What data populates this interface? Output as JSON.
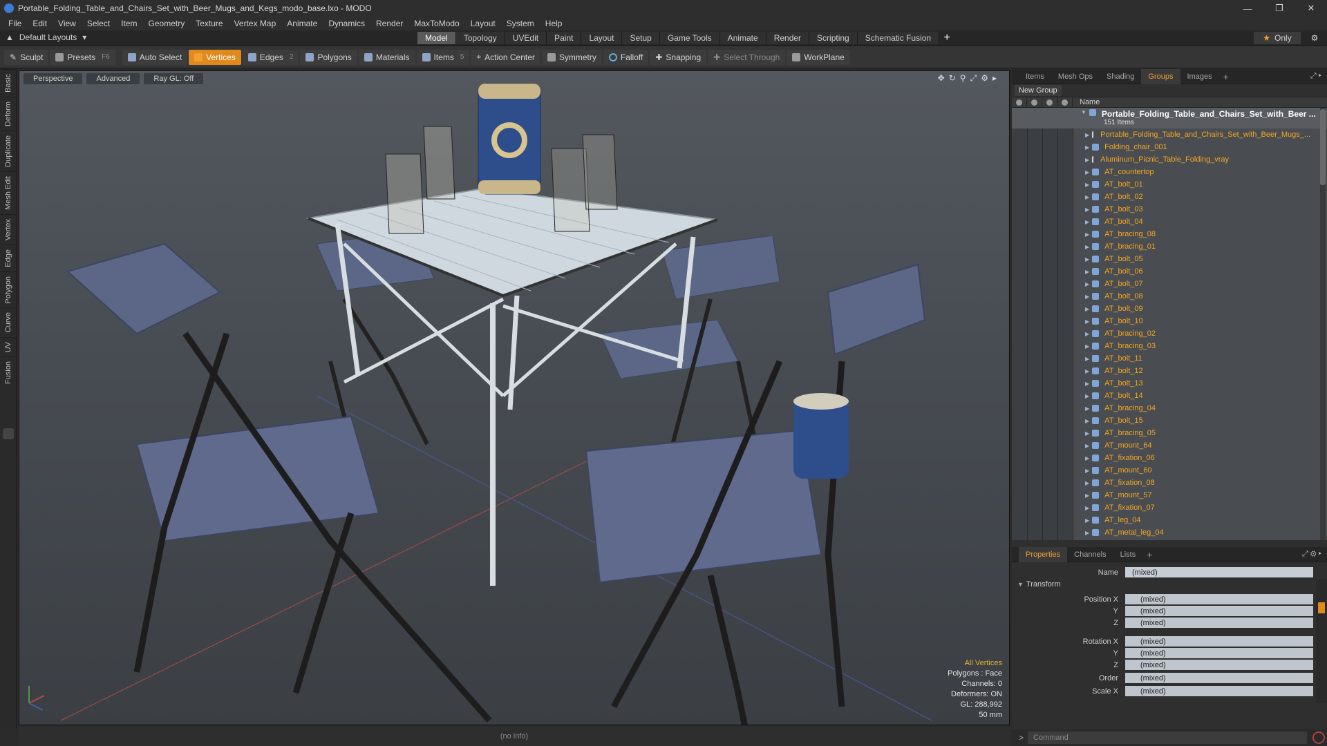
{
  "window": {
    "title": "Portable_Folding_Table_and_Chairs_Set_with_Beer_Mugs_and_Kegs_modo_base.lxo - MODO"
  },
  "menu": [
    "File",
    "Edit",
    "View",
    "Select",
    "Item",
    "Geometry",
    "Texture",
    "Vertex Map",
    "Animate",
    "Dynamics",
    "Render",
    "MaxToModo",
    "Layout",
    "System",
    "Help"
  ],
  "layouts": {
    "default": "Default Layouts",
    "tabs": [
      "Model",
      "Topology",
      "UVEdit",
      "Paint",
      "Layout",
      "Setup",
      "Game Tools",
      "Animate",
      "Render",
      "Scripting",
      "Schematic Fusion"
    ],
    "active": "Model",
    "only": "Only"
  },
  "toolbar": {
    "sculpt": "Sculpt",
    "presets": "Presets",
    "presets_hint": "F6",
    "auto_select": "Auto Select",
    "vertices": "Vertices",
    "edges": "Edges",
    "edges_hint": "2",
    "polygons": "Polygons",
    "materials": "Materials",
    "items": "Items",
    "items_hint": "5",
    "action_center": "Action Center",
    "symmetry": "Symmetry",
    "falloff": "Falloff",
    "snapping": "Snapping",
    "select_through": "Select Through",
    "workplane": "WorkPlane"
  },
  "left_tabs": [
    "Basic",
    "Deform",
    "Duplicate",
    "Mesh Edit",
    "Vertex",
    "Edge",
    "Polygon",
    "Curve",
    "UV",
    "Fusion"
  ],
  "viewport": {
    "view": "Perspective",
    "shading": "Advanced",
    "raygl": "Ray GL: Off",
    "info": {
      "selection": "All Vertices",
      "polygons": "Polygons : Face",
      "channels": "Channels: 0",
      "deformers": "Deformers: ON",
      "gl": "GL: 288,992",
      "focal": "50 mm"
    },
    "status": "(no info)"
  },
  "items_panel": {
    "tabs": [
      "Items",
      "Mesh Ops",
      "Shading",
      "Groups",
      "Images"
    ],
    "active": "Groups",
    "new_group": "New Group",
    "name_header": "Name",
    "root": {
      "name": "Portable_Folding_Table_and_Chairs_Set_with_Beer ...",
      "count": "151 Items"
    },
    "rows": [
      "Portable_Folding_Table_and_Chairs_Set_with_Beer_Mugs_...",
      "Folding_chair_001",
      "Aluminum_Picnic_Table_Folding_vray",
      "AT_countertop",
      "AT_bolt_01",
      "AT_bolt_02",
      "AT_bolt_03",
      "AT_bolt_04",
      "AT_bracing_08",
      "AT_bracing_01",
      "AT_bolt_05",
      "AT_bolt_06",
      "AT_bolt_07",
      "AT_bolt_08",
      "AT_bolt_09",
      "AT_bolt_10",
      "AT_bracing_02",
      "AT_bracing_03",
      "AT_bolt_11",
      "AT_bolt_12",
      "AT_bolt_13",
      "AT_bolt_14",
      "AT_bracing_04",
      "AT_bolt_15",
      "AT_bracing_05",
      "AT_mount_64",
      "AT_fixation_06",
      "AT_mount_60",
      "AT_fixation_08",
      "AT_mount_57",
      "AT_fixation_07",
      "AT_leg_04",
      "AT_metal_leg_04"
    ]
  },
  "properties_panel": {
    "tabs": [
      "Properties",
      "Channels",
      "Lists"
    ],
    "active": "Properties",
    "name_label": "Name",
    "name_value": "(mixed)",
    "transform": "Transform",
    "position": {
      "x_label": "Position X",
      "y_label": "Y",
      "z_label": "Z",
      "x": "(mixed)",
      "y": "(mixed)",
      "z": "(mixed)"
    },
    "rotation": {
      "x_label": "Rotation X",
      "y_label": "Y",
      "z_label": "Z",
      "x": "(mixed)",
      "y": "(mixed)",
      "z": "(mixed)"
    },
    "order_label": "Order",
    "order_value": "(mixed)",
    "scale_label": "Scale X",
    "scale_value": "(mixed)"
  },
  "command": {
    "placeholder": "Command"
  },
  "colors": {
    "accent": "#e08a1e",
    "group_item": "#f5a623",
    "viewport_bg": "#4b5056"
  }
}
